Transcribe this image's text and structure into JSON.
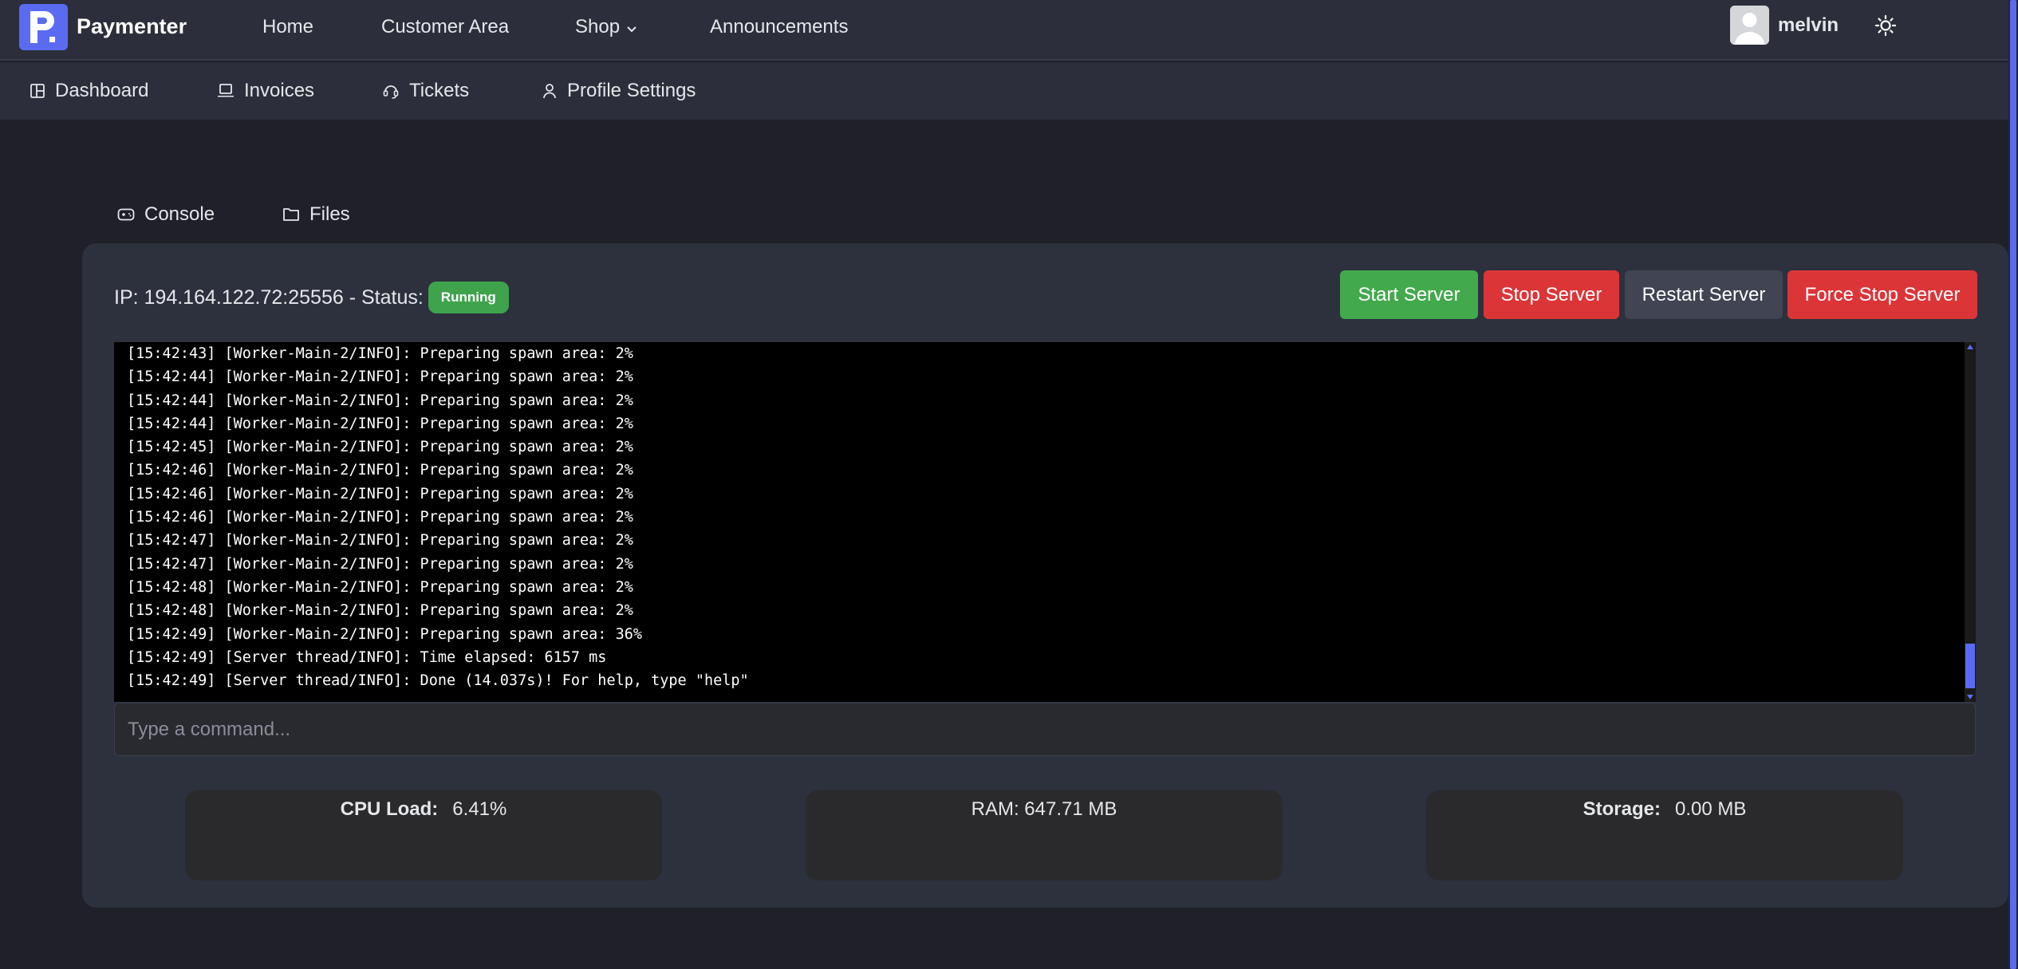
{
  "brand": {
    "name": "Paymenter"
  },
  "nav": {
    "home": "Home",
    "customer_area": "Customer Area",
    "shop": "Shop",
    "announcements": "Announcements"
  },
  "user": {
    "name": "melvin"
  },
  "subnav": {
    "dashboard": "Dashboard",
    "invoices": "Invoices",
    "tickets": "Tickets",
    "profile_settings": "Profile Settings"
  },
  "tabs": {
    "console": "Console",
    "files": "Files"
  },
  "server": {
    "ip_label": "IP: 194.164.122.72:25556 - Status:",
    "status": "Running",
    "status_color": "#3fa34d"
  },
  "actions": {
    "start": "Start Server",
    "stop": "Stop Server",
    "restart": "Restart Server",
    "force_stop": "Force Stop Server"
  },
  "console_lines": [
    "[15:42:43] [Worker-Main-2/INFO]: Preparing spawn area: 2%",
    "[15:42:44] [Worker-Main-2/INFO]: Preparing spawn area: 2%",
    "[15:42:44] [Worker-Main-2/INFO]: Preparing spawn area: 2%",
    "[15:42:44] [Worker-Main-2/INFO]: Preparing spawn area: 2%",
    "[15:42:45] [Worker-Main-2/INFO]: Preparing spawn area: 2%",
    "[15:42:46] [Worker-Main-2/INFO]: Preparing spawn area: 2%",
    "[15:42:46] [Worker-Main-2/INFO]: Preparing spawn area: 2%",
    "[15:42:46] [Worker-Main-2/INFO]: Preparing spawn area: 2%",
    "[15:42:47] [Worker-Main-2/INFO]: Preparing spawn area: 2%",
    "[15:42:47] [Worker-Main-2/INFO]: Preparing spawn area: 2%",
    "[15:42:48] [Worker-Main-2/INFO]: Preparing spawn area: 2%",
    "[15:42:48] [Worker-Main-2/INFO]: Preparing spawn area: 2%",
    "[15:42:49] [Worker-Main-2/INFO]: Preparing spawn area: 36%",
    "[15:42:49] [Server thread/INFO]: Time elapsed: 6157 ms",
    "[15:42:49] [Server thread/INFO]: Done (14.037s)! For help, type \"help\""
  ],
  "command": {
    "placeholder": "Type a command...",
    "value": ""
  },
  "stats": {
    "cpu_label": "CPU Load:",
    "cpu_value": "6.41%",
    "ram_label": "RAM: 647.71 MB",
    "storage_label": "Storage:",
    "storage_value": "0.00 MB"
  },
  "colors": {
    "accent": "#5a6bf2",
    "start": "#43a94d",
    "stop": "#dc3538",
    "restart": "#404453"
  }
}
